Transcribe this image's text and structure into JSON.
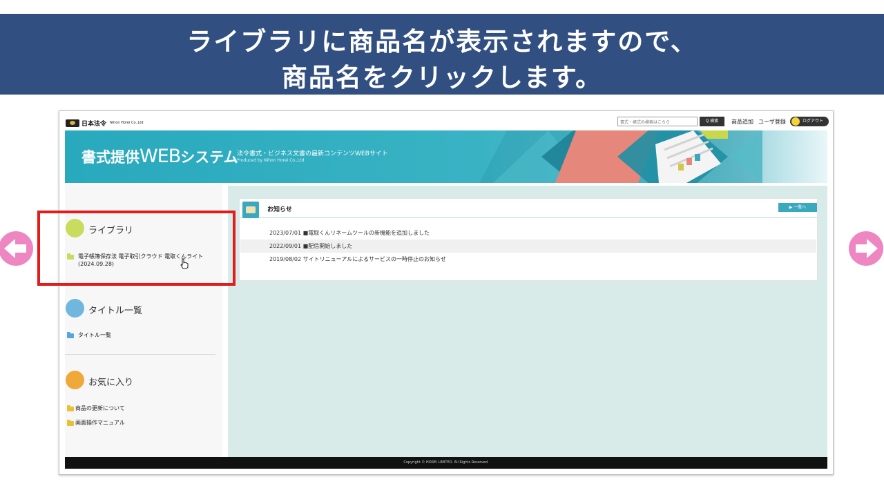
{
  "banner": {
    "line1": "ライブラリに商品名が表示されますので、",
    "line2": "商品名をクリックします。"
  },
  "site": {
    "logo_text": "日本法令",
    "logo_en": "Nihon Horei Co.,Ltd",
    "search_placeholder": "書式・帳式の検索はこちら",
    "search_button": "Q 検索",
    "top_links": [
      "商品追加",
      "ユーザ登録"
    ],
    "logout": "ログアウト",
    "header_title_prefix": "書式提供",
    "header_title_web": "WEB",
    "header_title_suffix": "システム",
    "header_sub1": "法令書式・ビジネス文書の最新コンテンツWEBサイト",
    "header_sub2": "Produced by Nihon Horei Co.,Ltd"
  },
  "sidebar": {
    "library": {
      "title": "ライブラリ",
      "item": "電子帳簿保存法 電子取引クラウド 電取くんライト",
      "item_date": "(2024.09.28)"
    },
    "titles": {
      "title": "タイトル一覧",
      "item": "タイトル一覧"
    },
    "favorites": {
      "title": "お気に入り",
      "items": [
        "商品の更新について",
        "画面操作マニュアル"
      ]
    }
  },
  "notice": {
    "title": "お知らせ",
    "more": "▶ 一覧へ",
    "rows": [
      "2023/07/01 ■電取くんリネームツールの新機能を追加しました",
      "2022/09/01 ■配信開始しました",
      "2019/08/02 サイトリニューアルによるサービスの一時停止のお知らせ"
    ]
  },
  "footer": "Copyright © HOREI LIMITED. All Rights Reserved.",
  "colors": {
    "banner": "#324f82",
    "accent": "#3aa9c0",
    "highlight": "#e31b1b",
    "nav_arrow": "#ee86c1"
  }
}
